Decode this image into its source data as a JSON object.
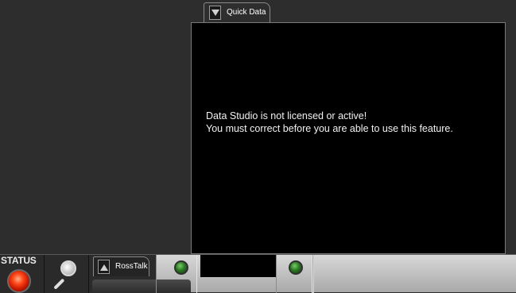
{
  "quick_data": {
    "tab_label": "Quick Data",
    "message_line1": "Data Studio is not licensed or active!",
    "message_line2": "You must correct before you are able to use this feature."
  },
  "toolbar": {
    "status_label": "STATUS",
    "rosstalk_label": "RossTalk"
  },
  "colors": {
    "status_light": "#ff3a10",
    "led_green": "#2b7a22",
    "panel_bg": "#000000",
    "app_bg": "#2d2d2d"
  },
  "icons": [
    "dropdown-arrow-icon",
    "collapse-up-arrow-icon",
    "magnifier-icon",
    "status-light-icon",
    "led-indicator-icon"
  ]
}
